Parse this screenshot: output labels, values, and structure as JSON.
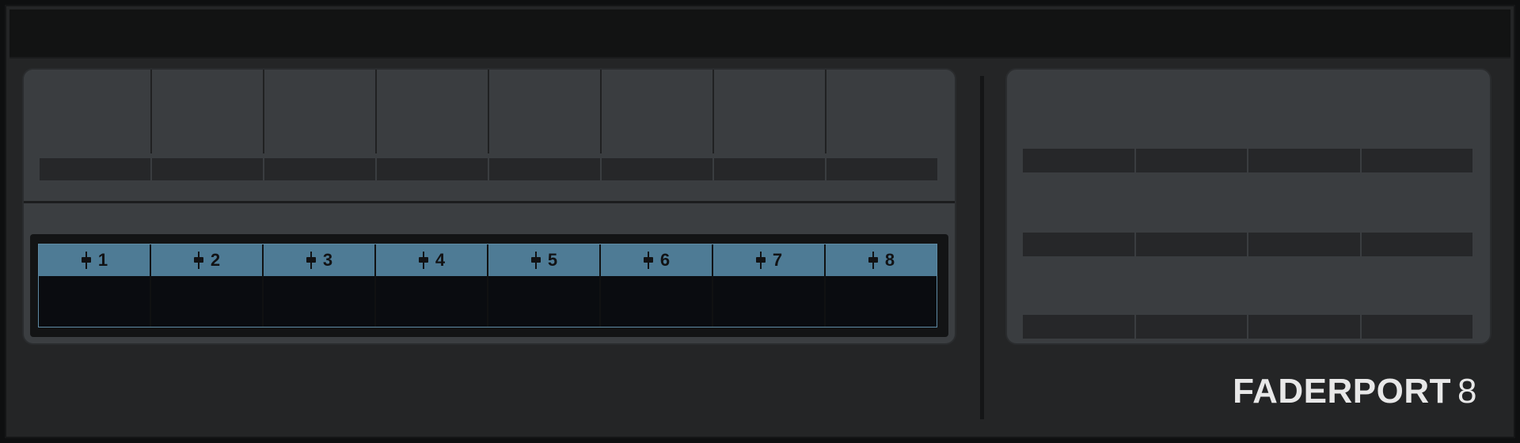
{
  "brand": {
    "name": "FADERPORT",
    "model": "8"
  },
  "channels": [
    {
      "label": "1",
      "icon": "fader-icon"
    },
    {
      "label": "2",
      "icon": "fader-icon"
    },
    {
      "label": "3",
      "icon": "fader-icon"
    },
    {
      "label": "4",
      "icon": "fader-icon"
    },
    {
      "label": "5",
      "icon": "fader-icon"
    },
    {
      "label": "6",
      "icon": "fader-icon"
    },
    {
      "label": "7",
      "icon": "fader-icon"
    },
    {
      "label": "8",
      "icon": "fader-icon"
    }
  ],
  "colors": {
    "channel_header": "#4e7b95",
    "display_body": "#0a0c10",
    "panel": "#3a3d40",
    "background": "#242526"
  }
}
